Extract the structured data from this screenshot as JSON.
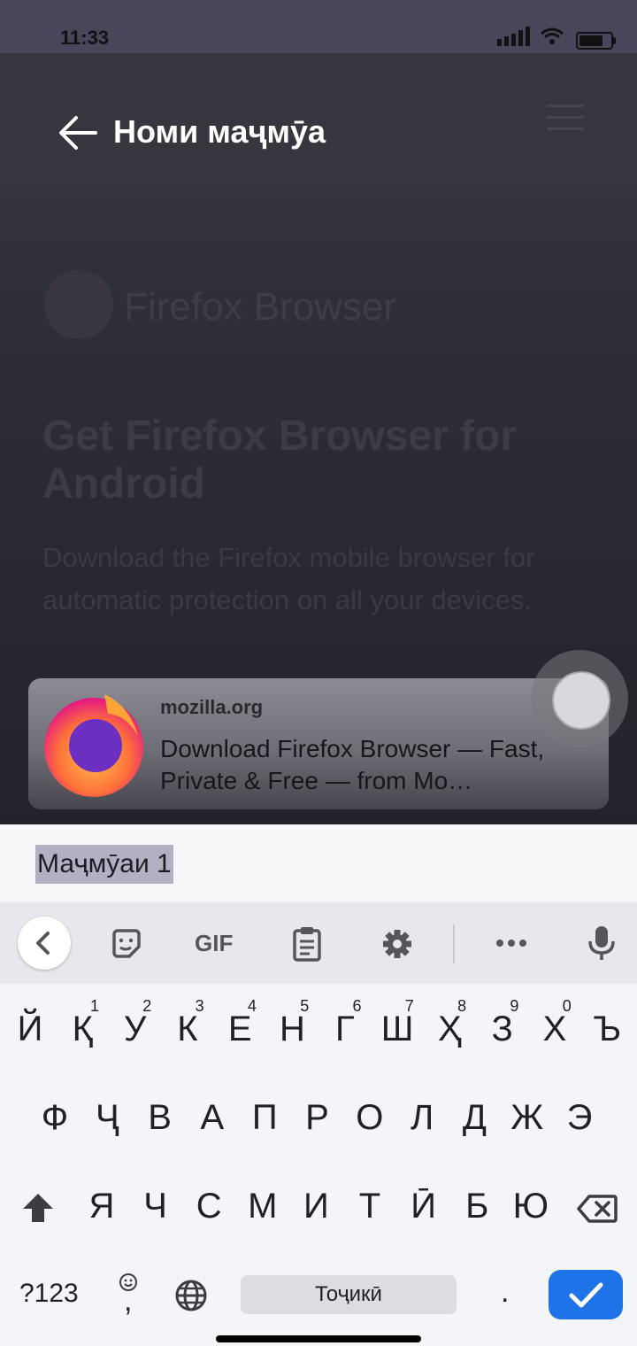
{
  "status_bar": {
    "time": "11:33"
  },
  "dialog": {
    "title": "Номи маҷмӯа",
    "input_value": "Маҷмӯаи 1"
  },
  "background_page": {
    "logo_text": "Firefox Browser",
    "heading": "Get Firefox Browser for Android",
    "paragraph": "Download the Firefox mobile browser for automatic protection on all your devices."
  },
  "preview_card": {
    "domain": "mozilla.org",
    "title": "Download Firefox Browser — Fast, Private & Free — from Mo…"
  },
  "keyboard": {
    "toolbar": {
      "gif_label": "GIF",
      "icons": [
        "back-icon",
        "sticker-icon",
        "gif-icon",
        "clipboard-icon",
        "settings-icon",
        "more-icon",
        "microphone-icon"
      ]
    },
    "row1": [
      "Й",
      "Қ",
      "У",
      "К",
      "Е",
      "Н",
      "Г",
      "Ш",
      "Ҳ",
      "З",
      "Х",
      "Ъ"
    ],
    "row1_hints": [
      "1",
      "2",
      "3",
      "4",
      "5",
      "6",
      "7",
      "8",
      "9",
      "0"
    ],
    "row2": [
      "Ф",
      "Ҷ",
      "В",
      "А",
      "П",
      "Р",
      "О",
      "Л",
      "Д",
      "Ж",
      "Э"
    ],
    "row3": [
      "Я",
      "Ч",
      "С",
      "М",
      "И",
      "Т",
      "Ӣ",
      "Б",
      "Ю"
    ],
    "symbols_label": "?123",
    "comma_label": ",",
    "space_label": "Тоҷикӣ",
    "period_label": "."
  },
  "colors": {
    "enter_key": "#1f73e8",
    "selection": "#b3b0c4"
  }
}
